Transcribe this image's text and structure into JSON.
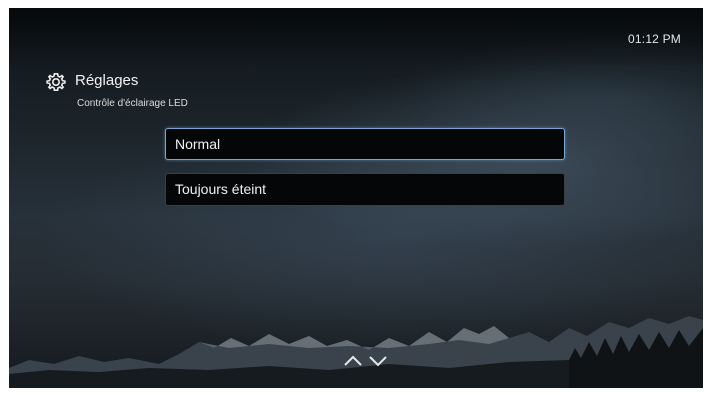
{
  "header": {
    "time": "01:12 PM"
  },
  "page": {
    "title": "Réglages",
    "subtitle": "Contrôle d'éclairage LED",
    "icon": "gear-icon"
  },
  "options": [
    {
      "label": "Normal",
      "selected": true
    },
    {
      "label": "Toujours éteint",
      "selected": false
    }
  ],
  "navigation": {
    "icons": [
      "chevron-up-icon",
      "chevron-down-icon"
    ]
  },
  "colors": {
    "selection_border": "#7aa6d6",
    "option_bg": "#050607"
  }
}
